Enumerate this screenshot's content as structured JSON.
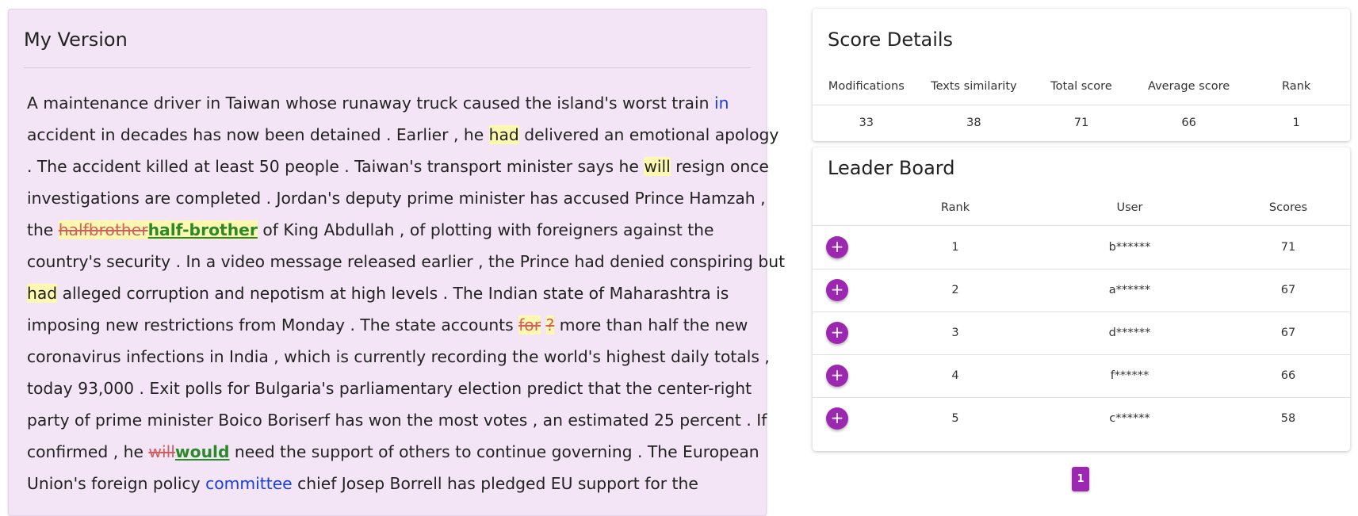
{
  "my_version": {
    "title": "My Version",
    "lines": [
      [
        {
          "t": "A maintenance driver in Taiwan whose runaway truck caused the island's worst train "
        },
        {
          "t": "in",
          "c": "blue"
        }
      ],
      [
        {
          "t": "accident in decades has now been detained . Earlier , he "
        },
        {
          "t": "had",
          "c": "hl"
        },
        {
          "t": " delivered an emotional apology"
        }
      ],
      [
        {
          "t": ". The accident killed at least 50 people . Taiwan's transport minister says he "
        },
        {
          "t": "will",
          "c": "hl"
        },
        {
          "t": " resign once"
        }
      ],
      [
        {
          "t": "investigations are completed . Jordan's deputy prime minister has accused Prince Hamzah ,"
        }
      ],
      [
        {
          "t": "the "
        },
        {
          "t": "halfbrother",
          "c": "hl del"
        },
        {
          "t": "half-brother",
          "c": "hl ins"
        },
        {
          "t": " of King Abdullah , of plotting with foreigners against the"
        }
      ],
      [
        {
          "t": "country's security . In a video message released earlier , the Prince had denied conspiring but"
        }
      ],
      [
        {
          "t": "had",
          "c": "hl"
        },
        {
          "t": " alleged corruption and nepotism at high levels . The Indian state of Maharashtra is"
        }
      ],
      [
        {
          "t": "imposing new restrictions from Monday . The state accounts "
        },
        {
          "t": "for",
          "c": "hl del"
        },
        {
          "t": " "
        },
        {
          "t": "?",
          "c": "hl del"
        },
        {
          "t": " more than half the new"
        }
      ],
      [
        {
          "t": "coronavirus infections in India , which is currently recording the world's highest daily totals ,"
        }
      ],
      [
        {
          "t": "today 93,000 . Exit polls for Bulgaria's parliamentary election predict that the center-right"
        }
      ],
      [
        {
          "t": "party of prime minister Boico Boriserf has won the most votes , an estimated 25 percent . If"
        }
      ],
      [
        {
          "t": "confirmed , he "
        },
        {
          "t": "will",
          "c": "del"
        },
        {
          "t": "would",
          "c": "ins"
        },
        {
          "t": " need the support of others to continue governing . The European"
        }
      ],
      [
        {
          "t": "Union's foreign policy "
        },
        {
          "t": "committee",
          "c": "blue"
        },
        {
          "t": " chief Josep Borrell has pledged EU support for the"
        }
      ]
    ]
  },
  "score_details": {
    "title": "Score Details",
    "headers": [
      "Modifications",
      "Texts similarity",
      "Total score",
      "Average score",
      "Rank"
    ],
    "values": [
      "33",
      "38",
      "71",
      "66",
      "1"
    ]
  },
  "leader_board": {
    "title": "Leader Board",
    "headers": {
      "rank": "Rank",
      "user": "User",
      "scores": "Scores"
    },
    "add_icon": "plus-icon",
    "rows": [
      {
        "rank": "1",
        "user": "b******",
        "score": "71"
      },
      {
        "rank": "2",
        "user": "a******",
        "score": "67"
      },
      {
        "rank": "3",
        "user": "d******",
        "score": "67"
      },
      {
        "rank": "4",
        "user": "f******",
        "score": "66"
      },
      {
        "rank": "5",
        "user": "c******",
        "score": "58"
      }
    ]
  },
  "pagination": {
    "current": "1"
  },
  "colors": {
    "panel_bg": "#f3e5f5",
    "accent": "#9c27b0",
    "highlight": "#fff8b0",
    "deleted": "#d06060",
    "inserted": "#2a8a2a",
    "link": "#1a3fd8"
  }
}
